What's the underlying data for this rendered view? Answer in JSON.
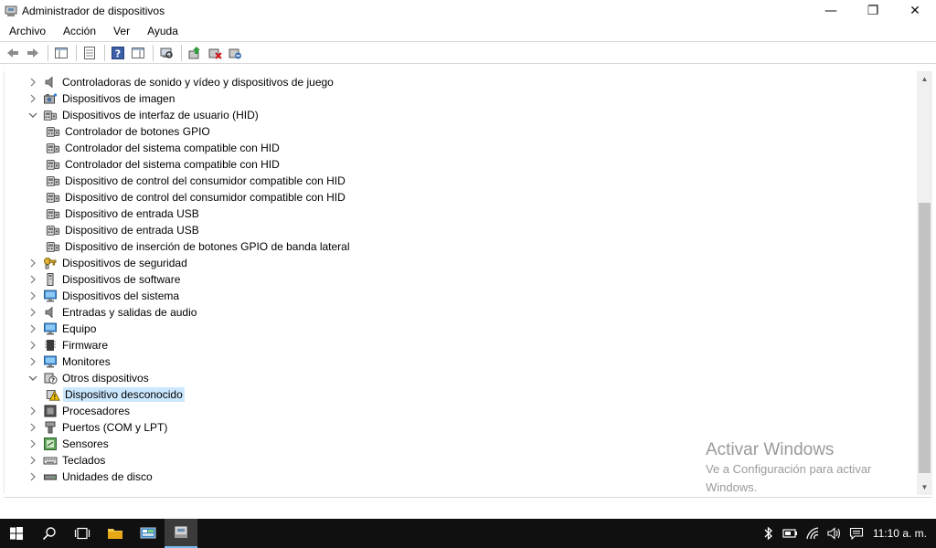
{
  "window": {
    "title": "Administrador de dispositivos",
    "controls": {
      "minimize": "—",
      "maximize": "❐",
      "close": "✕"
    }
  },
  "menu": [
    "Archivo",
    "Acción",
    "Ver",
    "Ayuda"
  ],
  "toolbar": {
    "buttons": [
      "back-icon",
      "forward-icon",
      "show-hide-console-tree-icon",
      "properties-icon",
      "help-icon",
      "show-action-pane-icon",
      "scan-hardware-icon",
      "update-driver-icon",
      "uninstall-device-icon",
      "disable-device-icon"
    ]
  },
  "tree": [
    {
      "label": "Controladoras de sonido y vídeo y dispositivos de juego",
      "level": 0,
      "expanded": false,
      "icon": "speaker-icon"
    },
    {
      "label": "Dispositivos de imagen",
      "level": 0,
      "expanded": false,
      "icon": "camera-icon"
    },
    {
      "label": "Dispositivos de interfaz de usuario (HID)",
      "level": 0,
      "expanded": true,
      "icon": "hid-icon"
    },
    {
      "label": "Controlador de botones GPIO",
      "level": 1,
      "icon": "hid-icon"
    },
    {
      "label": "Controlador del sistema compatible con HID",
      "level": 1,
      "icon": "hid-icon"
    },
    {
      "label": "Controlador del sistema compatible con HID",
      "level": 1,
      "icon": "hid-icon"
    },
    {
      "label": "Dispositivo de control del consumidor compatible con HID",
      "level": 1,
      "icon": "hid-icon"
    },
    {
      "label": "Dispositivo de control del consumidor compatible con HID",
      "level": 1,
      "icon": "hid-icon"
    },
    {
      "label": "Dispositivo de entrada USB",
      "level": 1,
      "icon": "hid-icon"
    },
    {
      "label": "Dispositivo de entrada USB",
      "level": 1,
      "icon": "hid-icon"
    },
    {
      "label": "Dispositivo de inserción de botones GPIO de banda lateral",
      "level": 1,
      "icon": "hid-icon"
    },
    {
      "label": "Dispositivos de seguridad",
      "level": 0,
      "expanded": false,
      "icon": "key-icon"
    },
    {
      "label": "Dispositivos de software",
      "level": 0,
      "expanded": false,
      "icon": "software-device-icon"
    },
    {
      "label": "Dispositivos del sistema",
      "level": 0,
      "expanded": false,
      "icon": "monitor-icon"
    },
    {
      "label": "Entradas y salidas de audio",
      "level": 0,
      "expanded": false,
      "icon": "speaker-icon"
    },
    {
      "label": "Equipo",
      "level": 0,
      "expanded": false,
      "icon": "monitor-icon"
    },
    {
      "label": "Firmware",
      "level": 0,
      "expanded": false,
      "icon": "chip-icon"
    },
    {
      "label": "Monitores",
      "level": 0,
      "expanded": false,
      "icon": "monitor-icon"
    },
    {
      "label": "Otros dispositivos",
      "level": 0,
      "expanded": true,
      "icon": "unknown-device-icon"
    },
    {
      "label": "Dispositivo desconocido",
      "level": 1,
      "selected": true,
      "icon": "warning-device-icon"
    },
    {
      "label": "Procesadores",
      "level": 0,
      "expanded": false,
      "icon": "processor-icon"
    },
    {
      "label": "Puertos (COM y LPT)",
      "level": 0,
      "expanded": false,
      "icon": "port-icon"
    },
    {
      "label": "Sensores",
      "level": 0,
      "expanded": false,
      "icon": "sensor-icon"
    },
    {
      "label": "Teclados",
      "level": 0,
      "expanded": false,
      "icon": "keyboard-icon"
    },
    {
      "label": "Unidades de disco",
      "level": 0,
      "expanded": false,
      "icon": "disk-icon"
    }
  ],
  "watermark": {
    "title": "Activar Windows",
    "line1": "Ve a Configuración para activar",
    "line2": "Windows."
  },
  "taskbar": {
    "apps": [
      "start-icon",
      "search-icon",
      "task-view-icon",
      "file-explorer-icon",
      "control-panel-icon",
      "device-manager-taskbar-icon"
    ],
    "tray": [
      "bluetooth-icon",
      "battery-icon",
      "wifi-icon",
      "volume-icon",
      "notifications-icon"
    ],
    "clock": "11:10 a. m."
  },
  "colors": {
    "selection": "#cce8ff",
    "taskbar": "#101010",
    "watermark": "#9a9a9a"
  }
}
